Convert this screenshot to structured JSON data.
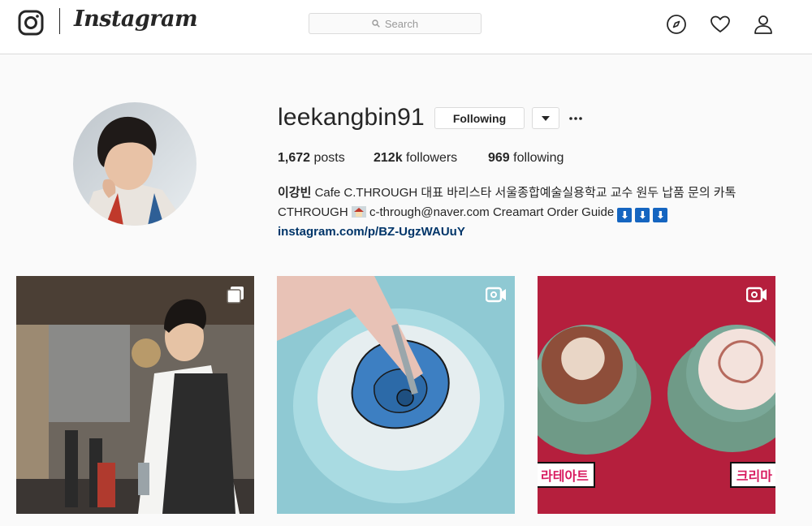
{
  "nav": {
    "brand": "Instagram",
    "search_placeholder": "Search",
    "icons": [
      "instagram-glyph-icon",
      "compass-icon",
      "heart-icon",
      "person-icon"
    ]
  },
  "profile": {
    "username": "leekangbin91",
    "follow_button": "Following",
    "stats": {
      "posts_count": "1,672",
      "posts_label": " posts",
      "followers_count": "212k",
      "followers_label": " followers",
      "following_count": "969",
      "following_label": " following"
    },
    "bio": {
      "name": "이강빈",
      "line1": " Cafe C.THROUGH 대표 바리스타 서울종합예술실용학교 교수 원두 납품 문의 카톡 CTHROUGH ",
      "email": " c-through@naver.com Creamart Order Guide ",
      "arrows": [
        "⬇",
        "⬇",
        "⬇"
      ],
      "link": "instagram.com/p/BZ-UgzWAUuY"
    }
  },
  "posts": [
    {
      "type": "carousel",
      "badge": "multiple-photos-icon"
    },
    {
      "type": "video",
      "badge": "video-icon"
    },
    {
      "type": "video",
      "badge": "video-icon",
      "caption_left": "라테아트",
      "caption_right": "크리마"
    }
  ],
  "colors": {
    "accent_link": "#003569",
    "border": "#dbdbdb",
    "background": "#fafafa"
  }
}
